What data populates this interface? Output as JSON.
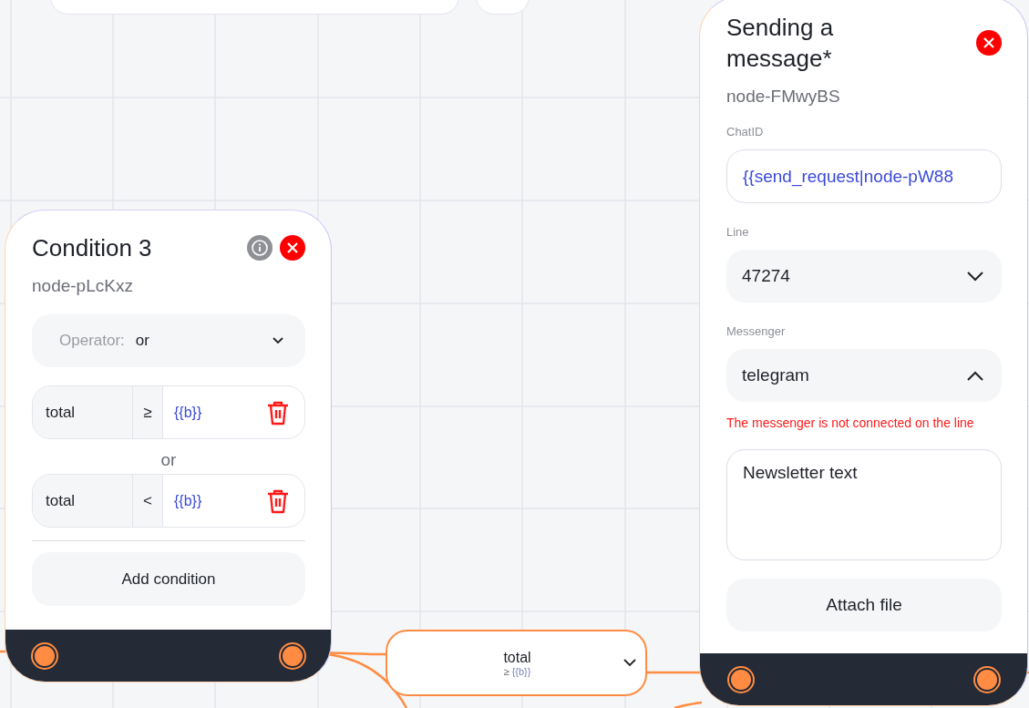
{
  "condition_node": {
    "title": "Condition 3",
    "node_id": "node-pLcKxz",
    "operator": {
      "label": "Operator:",
      "value": "or",
      "expanded": false
    },
    "conditions": [
      {
        "field": "total",
        "op": "≥",
        "value": "{{b}}"
      },
      {
        "field": "total",
        "op": "<",
        "value": "{{b}}"
      }
    ],
    "joiner": "or",
    "add_button": "Add condition"
  },
  "edge_node": {
    "label": "total",
    "op": "≥",
    "value": "{{b}}",
    "expanded": false
  },
  "message_node": {
    "title": "Sending a message*",
    "node_id": "node-FMwyBS",
    "fields": [
      {
        "kind": "input",
        "label": "ChatID",
        "value": "{{send_request|node-pW88"
      },
      {
        "kind": "select",
        "label": "Line",
        "value": "47274",
        "expanded": false
      },
      {
        "kind": "select",
        "label": "Messenger",
        "value": "telegram",
        "expanded": true,
        "error": "The messenger is not connected on the line"
      },
      {
        "kind": "textarea",
        "value": "Newsletter text"
      }
    ],
    "attach_button": "Attach file"
  }
}
